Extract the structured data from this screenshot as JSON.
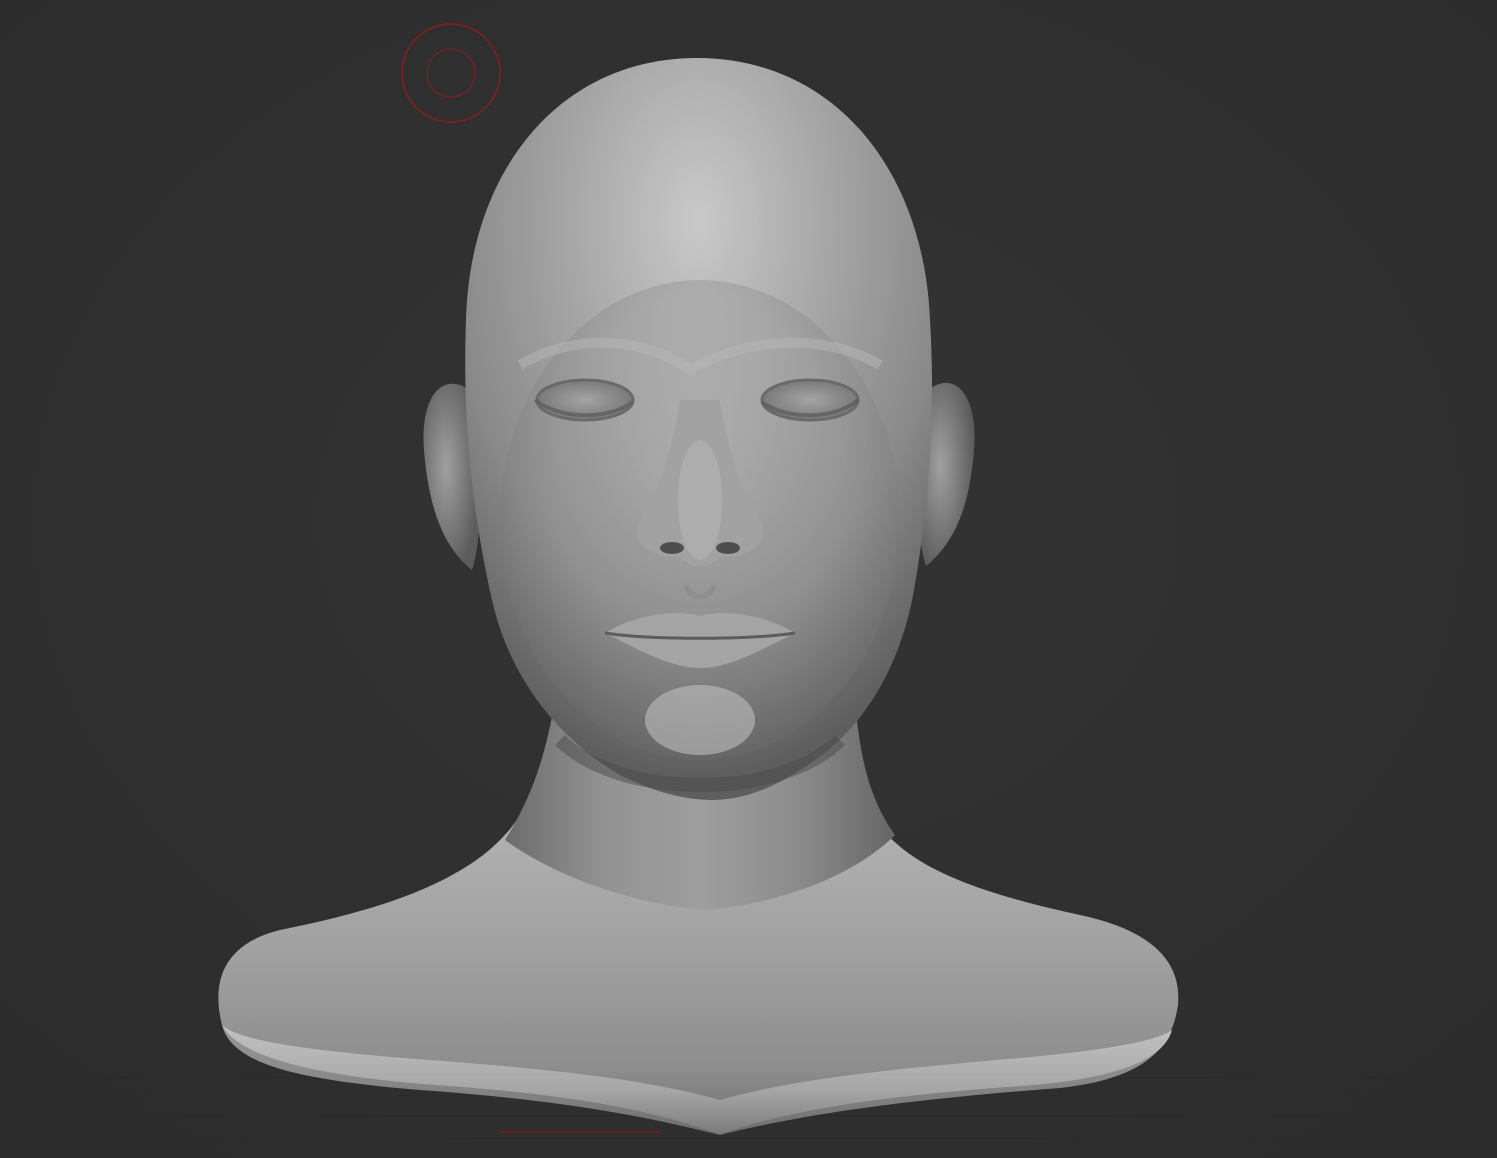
{
  "app": {
    "title": ""
  },
  "viewport": {
    "background_color": "#313131",
    "floor_grid_color": "#2a2a2a"
  },
  "model": {
    "name": "",
    "material_color": "#9a9a9a",
    "highlight_color": "#c8c8c8",
    "shadow_color": "#4a4a4a"
  },
  "brush_cursor": {
    "icon": "brush-cursor-icon",
    "color": "#8a1e1e"
  },
  "axis_line": {
    "color": "#7a1a1a"
  }
}
